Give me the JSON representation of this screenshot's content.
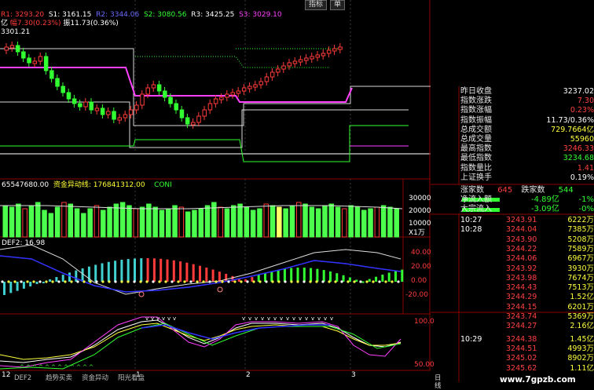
{
  "indicators_top": {
    "r1_label": "R1: 3293.20",
    "s1_label": "S1: 3161.15",
    "r2_label": "R2: 3344.06",
    "s2_label": "S2: 3080.56",
    "r3_label": "R3: 3425.25",
    "s3_label": "S3: 3029.10",
    "line2_a": "亿 ",
    "line2_b": "幅7.30(0.23%)",
    "line2_c": "振11.73(0.36%)",
    "price_label": "3301.21"
  },
  "volume_panel": {
    "value1": "65547680.00",
    "value2_label": "资金异动线: 176841312.00",
    "value3": "CONI",
    "axis": [
      "30000",
      "20000",
      "10000",
      "X1万"
    ]
  },
  "macd_panel": {
    "label": "DEF2: 16.98",
    "axis": [
      "40.00",
      "20.00",
      "0.00",
      "-20.00"
    ]
  },
  "kdj_panel": {
    "axis": [
      "100.0",
      "50.00"
    ]
  },
  "x_axis": {
    "marks": [
      "12",
      "1",
      "2",
      "3"
    ]
  },
  "bottom_tabs": [
    "DEF2",
    "趋势买卖",
    "资金异动",
    "阳光看盘"
  ],
  "bottom_right_tab": "日线",
  "top_buttons": [
    "指标",
    "单"
  ],
  "right_panel": {
    "rows": [
      {
        "label": "昨日收盘",
        "value": "3237.02",
        "color": "#ffffff"
      },
      {
        "label": "指数涨跌",
        "value": "7.30",
        "color": "#ff4040"
      },
      {
        "label": "指数涨幅",
        "value": "0.23%",
        "color": "#ff4040"
      },
      {
        "label": "指数振幅",
        "value": "11.73/0.36%",
        "color": "#ffffff"
      },
      {
        "label": "总成交额",
        "value": "729.7664亿",
        "color": "#ffff40"
      },
      {
        "label": "总成交量",
        "value": "55960",
        "color": "#ffff40"
      },
      {
        "label": "最高指数",
        "value": "3246.33",
        "color": "#ff4040"
      },
      {
        "label": "最低指数",
        "value": "3234.68",
        "color": "#32ff32"
      },
      {
        "label": "指数量比",
        "value": "1.41",
        "color": "#ff4040"
      },
      {
        "label": "上证换手",
        "value": "0.19%",
        "color": "#ffffff"
      }
    ],
    "rise_label": "涨家数",
    "rise_value": "645",
    "fall_label": "跌家数",
    "fall_value": "544",
    "flow": [
      {
        "label": "净流入额",
        "value": "-4.89亿",
        "pct": "-1%"
      },
      {
        "label": "大宗流入",
        "value": "-3.09亿",
        "pct": "-0%"
      }
    ],
    "ticks": [
      {
        "time": "10:27",
        "price": "3243.91",
        "vol": "6222万"
      },
      {
        "time": "10:28",
        "price": "3244.04",
        "vol": "7385万"
      },
      {
        "time": "",
        "price": "3243.90",
        "vol": "5208万"
      },
      {
        "time": "",
        "price": "3244.22",
        "vol": "7589万"
      },
      {
        "time": "",
        "price": "3244.06",
        "vol": "6967万"
      },
      {
        "time": "",
        "price": "3243.92",
        "vol": "3930万"
      },
      {
        "time": "",
        "price": "3243.98",
        "vol": "7674万"
      },
      {
        "time": "",
        "price": "3244.43",
        "vol": "7513万"
      },
      {
        "time": "",
        "price": "3244.29",
        "vol": "1.52亿"
      },
      {
        "time": "",
        "price": "3244.15",
        "vol": "6201万"
      },
      {
        "time": "",
        "price": "3243.74",
        "vol": "5369万"
      },
      {
        "time": "",
        "price": "3244.27",
        "vol": "2.16亿"
      },
      {
        "time": "10:29",
        "price": "3244.38",
        "vol": "1.45亿"
      },
      {
        "time": "",
        "price": "3244.51",
        "vol": "4993万"
      },
      {
        "time": "",
        "price": "3245.02",
        "vol": "8902万"
      },
      {
        "time": "",
        "price": "3245.62",
        "vol": "1.11亿"
      }
    ]
  },
  "watermark": "www.7gpzb.com"
}
